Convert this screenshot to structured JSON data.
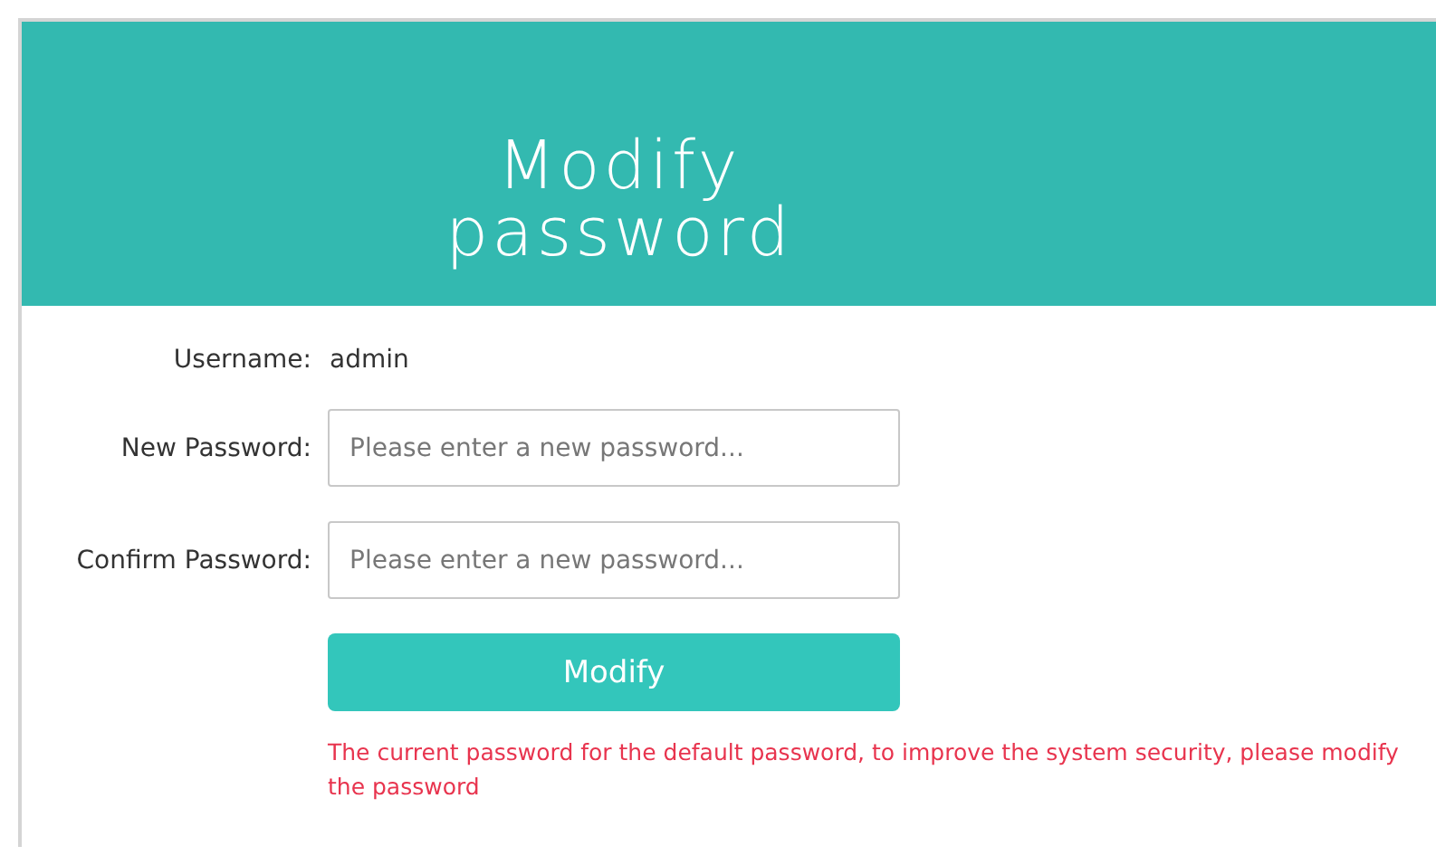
{
  "header": {
    "title": "Modify password"
  },
  "username": {
    "label": "Username:",
    "value": "admin"
  },
  "fields": [
    {
      "label": "New Password:",
      "placeholder": "Please enter a new password..."
    },
    {
      "label": "Confirm Password:",
      "placeholder": "Please enter a new password..."
    }
  ],
  "submit_button": "Modify",
  "warning": "The current password for the default password, to improve the system security, please modify the password"
}
